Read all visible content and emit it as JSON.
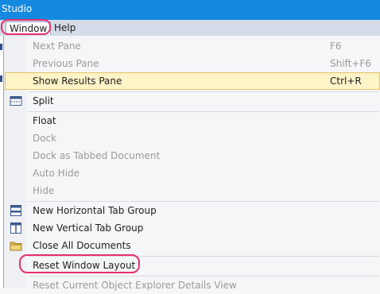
{
  "titlebar": {
    "title": "Studio"
  },
  "menubar": {
    "window": "Window",
    "help": "Help"
  },
  "menu": {
    "next_pane": {
      "label": "Next Pane",
      "shortcut": "F6"
    },
    "previous_pane": {
      "label": "Previous Pane",
      "shortcut": "Shift+F6"
    },
    "show_results": {
      "label": "Show Results Pane",
      "shortcut": "Ctrl+R"
    },
    "split": {
      "label": "Split",
      "icon": "split-window-icon"
    },
    "float": {
      "label": "Float"
    },
    "dock": {
      "label": "Dock"
    },
    "dock_tabbed": {
      "label": "Dock as Tabbed Document"
    },
    "auto_hide": {
      "label": "Auto Hide"
    },
    "hide": {
      "label": "Hide"
    },
    "new_h_tab_group": {
      "label": "New Horizontal Tab Group",
      "icon": "horizontal-tab-group-icon"
    },
    "new_v_tab_group": {
      "label": "New Vertical Tab Group",
      "icon": "vertical-tab-group-icon"
    },
    "close_all": {
      "label": "Close All Documents",
      "icon": "folder-icon"
    },
    "reset_layout": {
      "label": "Reset Window Layout"
    },
    "reset_explorer": {
      "label": "Reset Current Object Explorer Details View"
    }
  },
  "colors": {
    "titlebar": "#1389e0",
    "highlight_ring": "#e6306d",
    "hover_bg": "#fff3c8"
  }
}
